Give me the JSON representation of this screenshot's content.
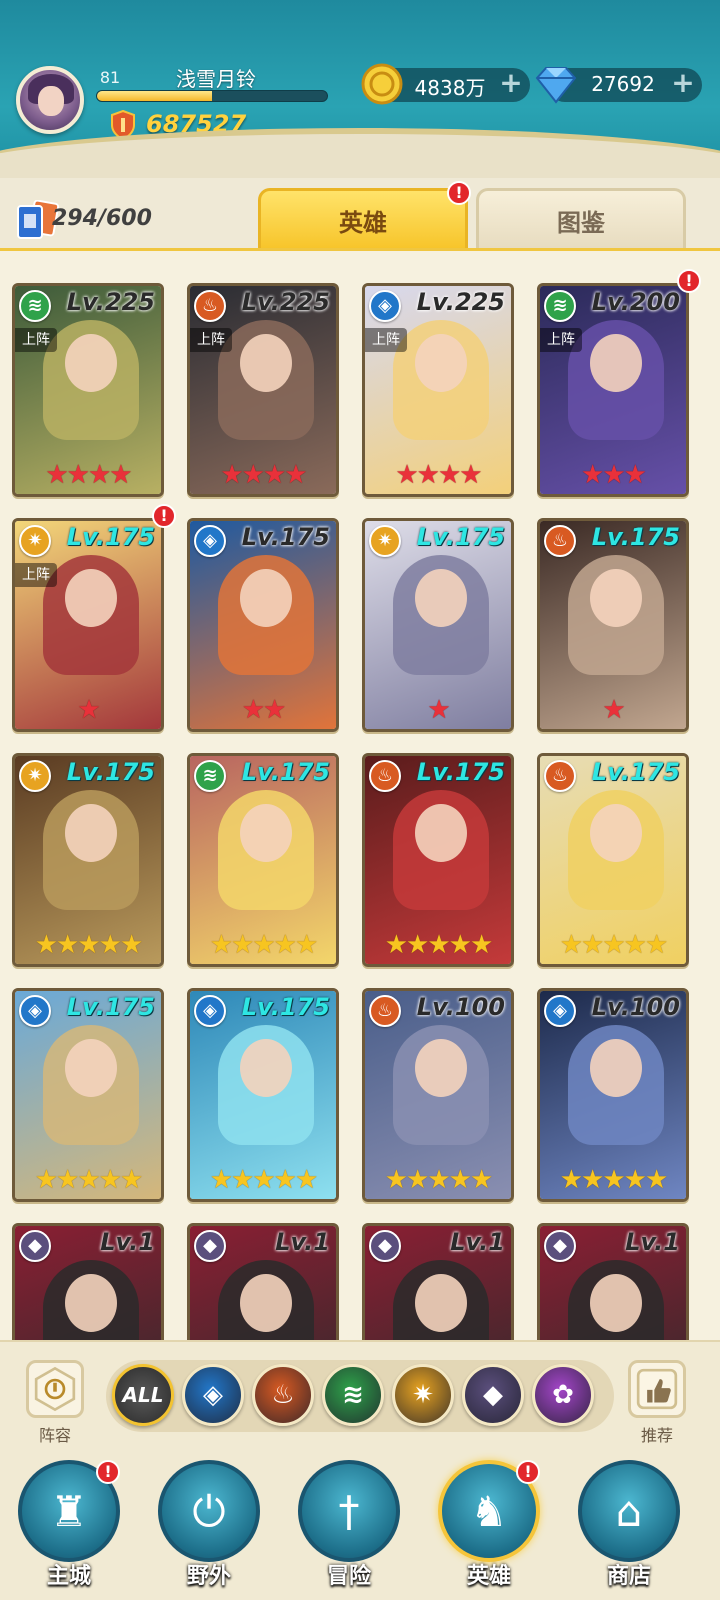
{
  "player": {
    "level": "81",
    "name": "浅雪月铃",
    "power": "687527",
    "exp_fraction": 0.5
  },
  "resources": {
    "gold": "4838万",
    "gems": "27692",
    "plus": "+"
  },
  "hero_count": "294/600",
  "tabs": {
    "hero": "英雄",
    "book": "图鉴",
    "badge": "!"
  },
  "heroes": [
    {
      "lv": "Lv.225",
      "deployed": "上阵",
      "element": "wind",
      "stars": "★★★★",
      "star_color": "red",
      "lv_style": "dark",
      "art": [
        "#3d5b3a",
        "#b8b063"
      ]
    },
    {
      "lv": "Lv.225",
      "deployed": "上阵",
      "element": "fire",
      "stars": "★★★★",
      "star_color": "red",
      "lv_style": "dark",
      "art": [
        "#2a2c33",
        "#8a6a5a"
      ]
    },
    {
      "lv": "Lv.225",
      "deployed": "上阵",
      "element": "water",
      "stars": "★★★★",
      "star_color": "red",
      "lv_style": "dark",
      "art": [
        "#d7d8ee",
        "#f3d07a"
      ]
    },
    {
      "lv": "Lv.200",
      "deployed": "上阵",
      "element": "wind",
      "stars": "★★★",
      "star_color": "red",
      "lv_style": "dark",
      "art": [
        "#2b2a59",
        "#6650a8"
      ]
    },
    {
      "lv": "Lv.175",
      "deployed": "上阵",
      "element": "light",
      "stars": "★",
      "star_color": "red",
      "lv_style": "cyan",
      "art": [
        "#f3d77a",
        "#a3373b"
      ]
    },
    {
      "lv": "Lv.175",
      "deployed": "",
      "element": "water",
      "stars": "★★",
      "star_color": "red",
      "lv_style": "dark",
      "art": [
        "#1f5aa0",
        "#e1743a"
      ]
    },
    {
      "lv": "Lv.175",
      "deployed": "",
      "element": "light",
      "stars": "★",
      "star_color": "red",
      "lv_style": "cyan",
      "art": [
        "#dedde8",
        "#7f7ea0"
      ]
    },
    {
      "lv": "Lv.175",
      "deployed": "",
      "element": "fire",
      "stars": "★",
      "star_color": "red",
      "lv_style": "cyan",
      "art": [
        "#3b2a25",
        "#c1a68f"
      ]
    },
    {
      "lv": "Lv.175",
      "deployed": "",
      "element": "light",
      "stars": "★★★★★",
      "star_color": "gold",
      "lv_style": "cyan",
      "art": [
        "#5a3b22",
        "#b99a5c"
      ]
    },
    {
      "lv": "Lv.175",
      "deployed": "",
      "element": "wind",
      "stars": "★★★★★",
      "star_color": "gold",
      "lv_style": "cyan",
      "art": [
        "#b86560",
        "#f3d66a"
      ]
    },
    {
      "lv": "Lv.175",
      "deployed": "",
      "element": "fire",
      "stars": "★★★★★",
      "star_color": "gold",
      "lv_style": "cyan",
      "art": [
        "#5a1c1c",
        "#c43a3a"
      ]
    },
    {
      "lv": "Lv.175",
      "deployed": "",
      "element": "fire",
      "stars": "★★★★★",
      "star_color": "gold",
      "lv_style": "cyan",
      "art": [
        "#e7dcb4",
        "#f0d061"
      ]
    },
    {
      "lv": "Lv.175",
      "deployed": "",
      "element": "water",
      "stars": "★★★★★",
      "star_color": "gold",
      "lv_style": "cyan",
      "art": [
        "#6aa9d8",
        "#d5b77a"
      ]
    },
    {
      "lv": "Lv.175",
      "deployed": "",
      "element": "water",
      "stars": "★★★★★",
      "star_color": "gold",
      "lv_style": "cyan",
      "art": [
        "#2e88b8",
        "#8ee0ef"
      ]
    },
    {
      "lv": "Lv.100",
      "deployed": "",
      "element": "fire",
      "stars": "★★★★★",
      "star_color": "gold",
      "lv_style": "dark",
      "art": [
        "#4a5e8a",
        "#8a8fb1"
      ]
    },
    {
      "lv": "Lv.100",
      "deployed": "",
      "element": "water",
      "stars": "★★★★★",
      "star_color": "gold",
      "lv_style": "dark",
      "art": [
        "#1d2a4b",
        "#6f86c2"
      ]
    },
    {
      "lv": "Lv.1",
      "deployed": "",
      "element": "dark",
      "stars": "",
      "star_color": "red",
      "lv_style": "dark",
      "art": [
        "#8a1f33",
        "#2a2a2a"
      ]
    },
    {
      "lv": "Lv.1",
      "deployed": "",
      "element": "dark",
      "stars": "",
      "star_color": "red",
      "lv_style": "dark",
      "art": [
        "#8a1f33",
        "#2a2a2a"
      ]
    },
    {
      "lv": "Lv.1",
      "deployed": "",
      "element": "dark",
      "stars": "",
      "star_color": "red",
      "lv_style": "dark",
      "art": [
        "#8a1f33",
        "#2a2a2a"
      ]
    },
    {
      "lv": "Lv.1",
      "deployed": "",
      "element": "dark",
      "stars": "",
      "star_color": "red",
      "lv_style": "dark",
      "art": [
        "#8a1f33",
        "#2a2a2a"
      ]
    }
  ],
  "hero_badges": [
    3,
    4
  ],
  "elements": {
    "wind": {
      "color": "#2fa24a",
      "glyph": "≋"
    },
    "fire": {
      "color": "#d85a22",
      "glyph": "♨"
    },
    "water": {
      "color": "#2277c9",
      "glyph": "◈"
    },
    "light": {
      "color": "#e7a321",
      "glyph": "✷"
    },
    "dark": {
      "color": "#5b4f7d",
      "glyph": "◆"
    },
    "arcane": {
      "color": "#a446c9",
      "glyph": "✿"
    }
  },
  "filter": {
    "left_label": "阵容",
    "right_label": "推荐",
    "all_label": "ALL",
    "buttons": [
      "water",
      "fire",
      "wind",
      "light",
      "dark",
      "arcane"
    ]
  },
  "nav": [
    {
      "label": "主城",
      "icon": "castle-icon",
      "glyph": "♜",
      "badge": true,
      "active": false
    },
    {
      "label": "野外",
      "icon": "wild-icon",
      "glyph": "⏻",
      "badge": false,
      "active": false
    },
    {
      "label": "冒险",
      "icon": "sword-icon",
      "glyph": "†",
      "badge": false,
      "active": false
    },
    {
      "label": "英雄",
      "icon": "helmet-icon",
      "glyph": "♞",
      "badge": true,
      "active": true
    },
    {
      "label": "商店",
      "icon": "shop-icon",
      "glyph": "⌂",
      "badge": false,
      "active": false
    }
  ]
}
